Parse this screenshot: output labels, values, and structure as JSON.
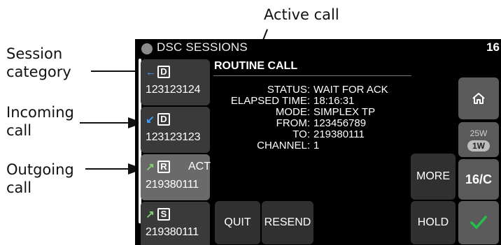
{
  "annotations": {
    "active_call": "Active call",
    "session_category": [
      "Session",
      "category"
    ],
    "incoming_call": [
      "Incoming",
      "call"
    ],
    "outgoing_call": [
      "Outgoing",
      "call"
    ]
  },
  "topbar": {
    "title": "DSC SESSIONS",
    "right_text": "16"
  },
  "sessions": [
    {
      "category": "D",
      "number": "123123124",
      "arrow": "←",
      "arrow_color": "#3aa0ff",
      "active_label": ""
    },
    {
      "category": "D",
      "number": "123123123",
      "arrow": "↙",
      "arrow_color": "#3aa0ff",
      "active_label": ""
    },
    {
      "category": "R",
      "number": "219380111",
      "arrow": "↗",
      "arrow_color": "#7fd36a",
      "active_label": "ACT"
    },
    {
      "category": "S",
      "number": "219380111",
      "arrow": "↗",
      "arrow_color": "#7fd36a",
      "active_label": ""
    }
  ],
  "call": {
    "title": "ROUTINE CALL",
    "fields": [
      {
        "key": "STATUS:",
        "value": "WAIT FOR ACK"
      },
      {
        "key": "ELAPSED TIME:",
        "value": "18:16:31"
      },
      {
        "key": "MODE:",
        "value": "SIMPLEX TP"
      },
      {
        "key": "FROM:",
        "value": "123456789"
      },
      {
        "key": "TO:",
        "value": "219380111"
      },
      {
        "key": "CHANNEL:",
        "value": "1"
      }
    ]
  },
  "buttons": {
    "quit": "QUIT",
    "resend": "RESEND",
    "more": "MORE",
    "hold": "HOLD",
    "power_high": "25W",
    "power_low": "1W",
    "channel_toggle": "16/C",
    "home_icon": "home-icon",
    "confirm_icon": "check-icon"
  },
  "colors": {
    "confirm_green": "#22c24a",
    "incoming_blue": "#3aa0ff",
    "outgoing_green": "#7fd36a"
  }
}
